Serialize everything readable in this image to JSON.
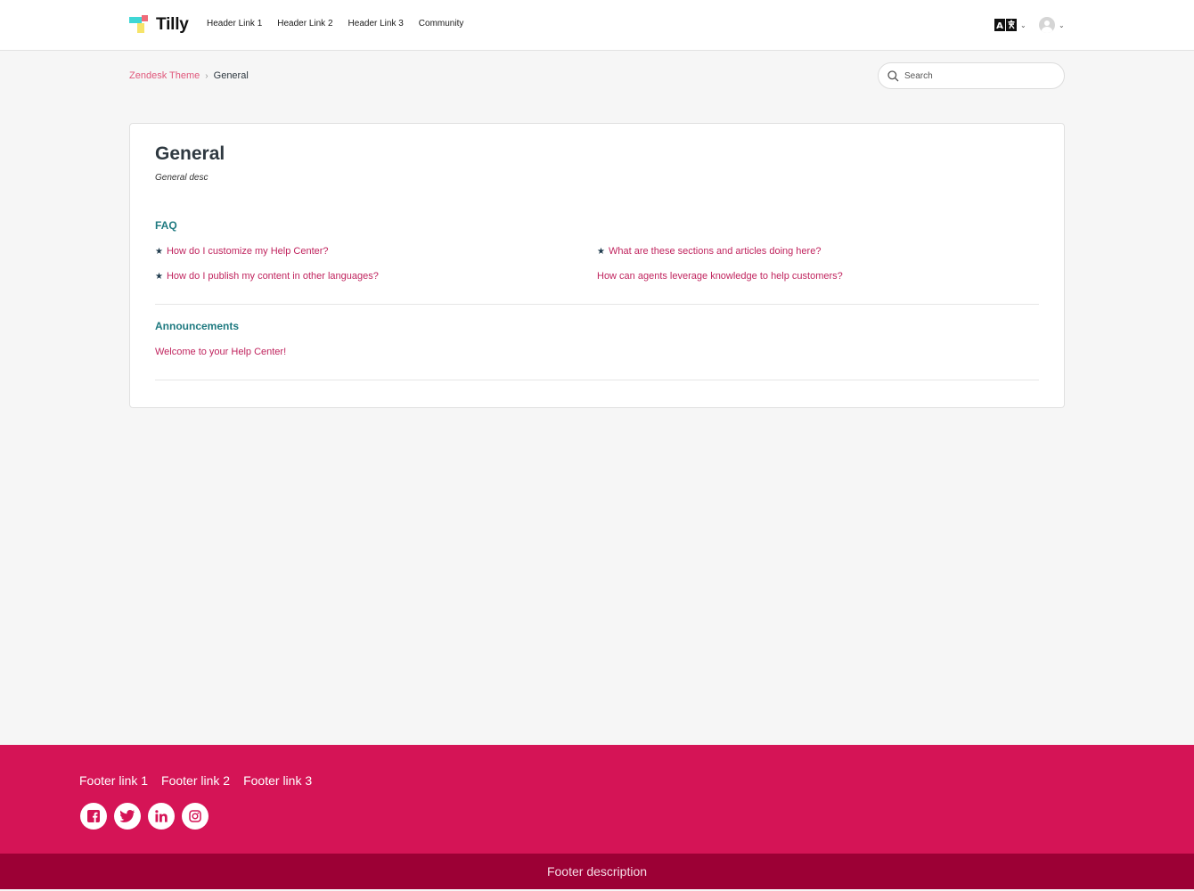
{
  "header": {
    "brand": "Tilly",
    "nav": [
      "Header Link 1",
      "Header Link 2",
      "Header Link 3",
      "Community"
    ],
    "language_icon": "translate-icon",
    "user_icon": "avatar-icon"
  },
  "breadcrumb": {
    "parent": "Zendesk Theme",
    "separator": "›",
    "current": "General"
  },
  "search": {
    "placeholder": "Search",
    "value": "",
    "icon": "search-icon"
  },
  "category": {
    "title": "General",
    "description": "General desc"
  },
  "sections": [
    {
      "title": "FAQ",
      "articles": [
        {
          "title": "How do I customize my Help Center?",
          "promoted": true
        },
        {
          "title": "What are these sections and articles doing here?",
          "promoted": true
        },
        {
          "title": "How do I publish my content in other languages?",
          "promoted": true
        },
        {
          "title": "How can agents leverage knowledge to help customers?",
          "promoted": false
        }
      ]
    },
    {
      "title": "Announcements",
      "articles": [
        {
          "title": "Welcome to your Help Center!",
          "promoted": false
        }
      ]
    }
  ],
  "footer": {
    "links": [
      "Footer link 1",
      "Footer link 2",
      "Footer link 3"
    ],
    "socials": [
      "facebook-icon",
      "twitter-icon",
      "linkedin-icon",
      "instagram-icon"
    ],
    "description": "Footer description"
  },
  "colors": {
    "accent_link": "#c0245e",
    "section_title": "#1f7a80",
    "footer_bg": "#d51456",
    "footer_bottom_bg": "#9c0035"
  }
}
